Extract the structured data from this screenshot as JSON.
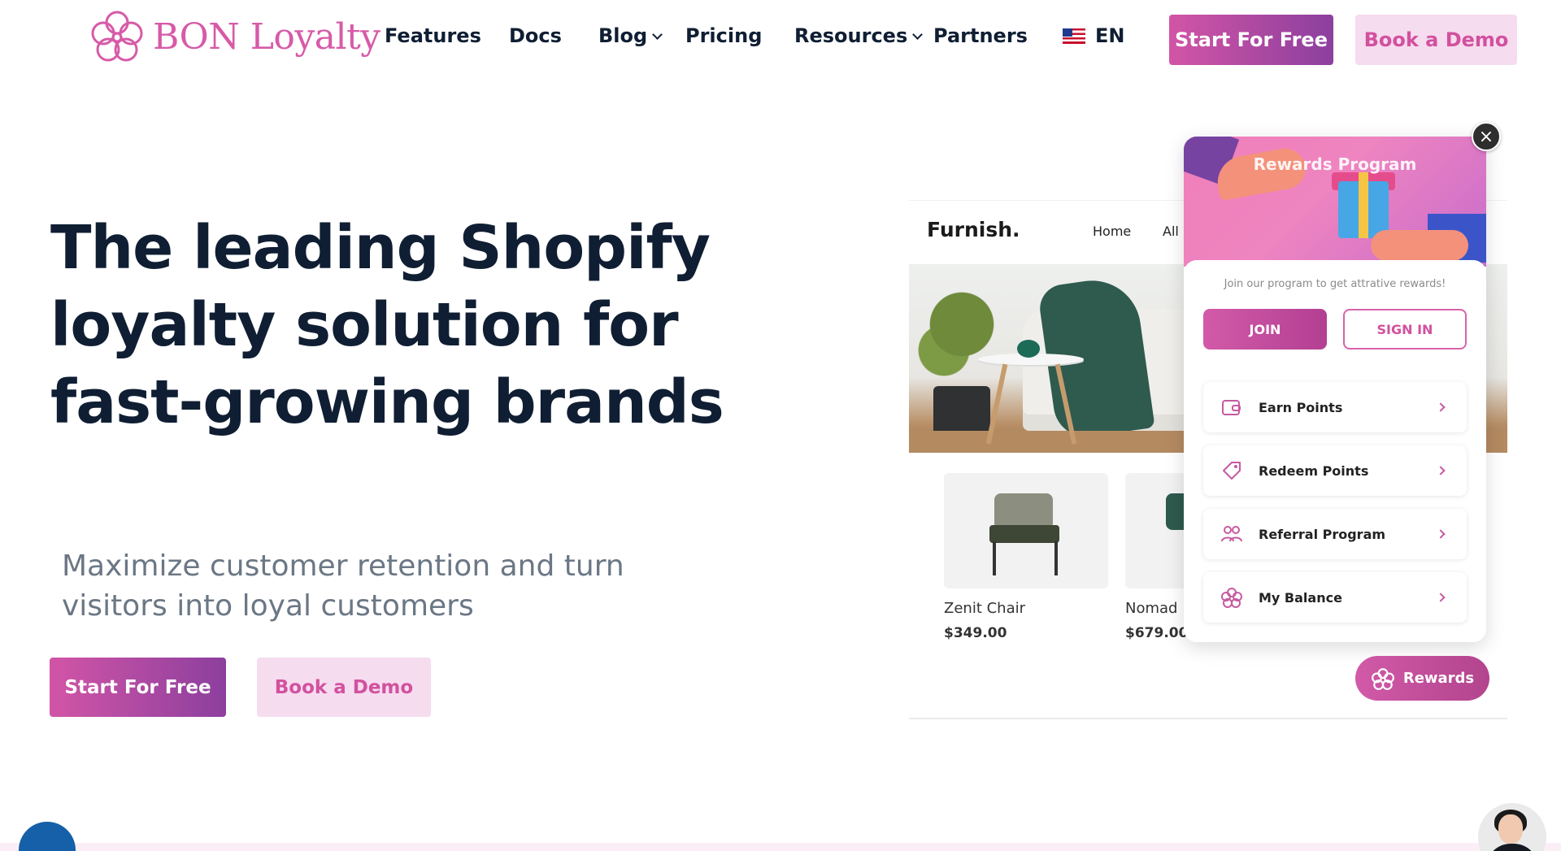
{
  "brand": {
    "name": "BON Loyalty"
  },
  "nav": {
    "features": "Features",
    "docs": "Docs",
    "blog": "Blog",
    "pricing": "Pricing",
    "resources": "Resources",
    "partners": "Partners",
    "language": "EN",
    "start_free": "Start For Free",
    "book_demo": "Book a Demo"
  },
  "hero": {
    "title": "The leading Shopify loyalty solution for fast-growing brands",
    "subtitle": "Maximize customer retention and turn visitors into loyal customers",
    "start_free": "Start For Free",
    "book_demo": "Book a Demo"
  },
  "store": {
    "brand": "Furnish.",
    "nav": [
      "Home",
      "All"
    ],
    "products": [
      {
        "name": "Zenit Chair",
        "price": "$349.00"
      },
      {
        "name": "Nomad",
        "price": "$679.00"
      }
    ]
  },
  "widget": {
    "title": "Rewards Program",
    "intro": "Join our program to get attrative rewards!",
    "join": "JOIN",
    "sign_in": "SIGN IN",
    "items": [
      {
        "label": "Earn Points",
        "icon": "wallet-icon"
      },
      {
        "label": "Redeem Points",
        "icon": "tag-icon"
      },
      {
        "label": "Referral Program",
        "icon": "users-icon"
      },
      {
        "label": "My Balance",
        "icon": "flower-icon"
      }
    ],
    "close": "×",
    "launcher": "Rewards"
  },
  "colors": {
    "accent": "#d2519f",
    "accent_dark": "#8c3f9e",
    "text": "#0f1e33",
    "muted": "#6b7785"
  }
}
